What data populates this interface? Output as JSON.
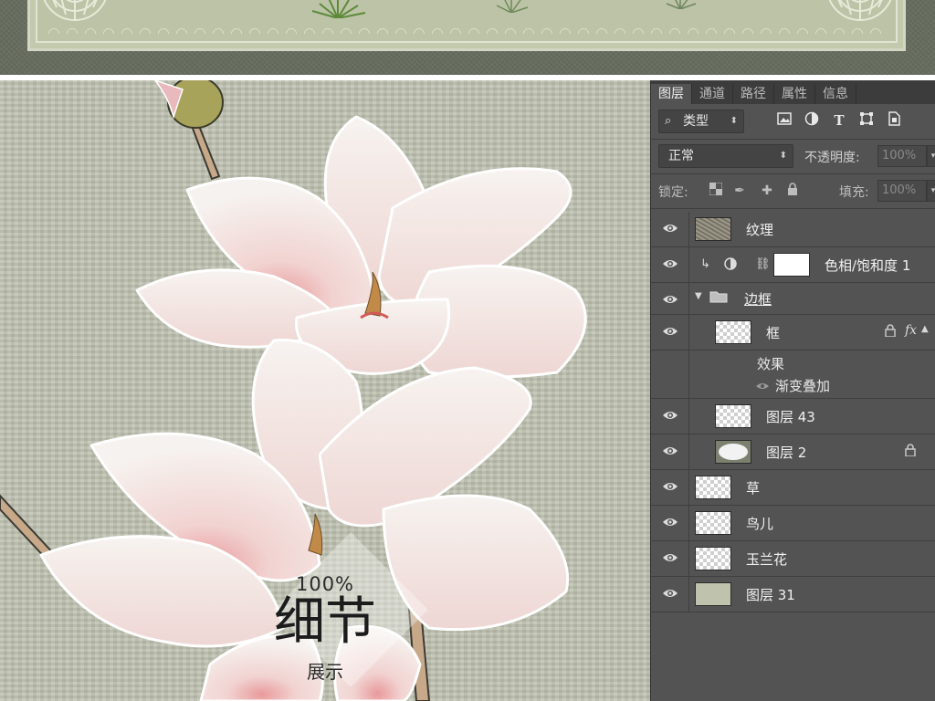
{
  "overlay": {
    "percent": "100%",
    "title": "细节",
    "subtitle": "展示"
  },
  "panel": {
    "tabs": [
      {
        "label": "图层",
        "active": true
      },
      {
        "label": "通道",
        "active": false
      },
      {
        "label": "路径",
        "active": false
      },
      {
        "label": "属性",
        "active": false
      },
      {
        "label": "信息",
        "active": false
      }
    ],
    "filter": {
      "type_label": "类型",
      "icons": [
        "image-filter-icon",
        "adjustment-filter-icon",
        "type-filter-icon",
        "shape-filter-icon",
        "smart-object-filter-icon"
      ]
    },
    "blend": {
      "mode": "正常",
      "opacity_label": "不透明度:",
      "opacity_value": "100%"
    },
    "lock": {
      "label": "锁定:",
      "fill_label": "填充:",
      "fill_value": "100%"
    },
    "layers": [
      {
        "name": "纹理",
        "thumb": "texture"
      },
      {
        "name": "色相/饱和度 1",
        "thumb": "adjustment"
      },
      {
        "name": "边框",
        "thumb": "group"
      },
      {
        "name": "框",
        "thumb": "checker"
      },
      {
        "name": "图层 43",
        "thumb": "checker"
      },
      {
        "name": "图层 2",
        "thumb": "checker"
      },
      {
        "name": "草",
        "thumb": "checker"
      },
      {
        "name": "鸟儿",
        "thumb": "checker"
      },
      {
        "name": "玉兰花",
        "thumb": "checker"
      },
      {
        "name": "图层 31",
        "thumb": "plain"
      }
    ],
    "effects": {
      "title": "效果",
      "item": "渐变叠加"
    }
  },
  "colors": {
    "panel_bg": "#535353",
    "tab_bar_bg": "#3c3c3c",
    "canvas_bg": "#bcbfae",
    "petal": "#f4eeea",
    "petal_pink": "#e9a6a6"
  }
}
